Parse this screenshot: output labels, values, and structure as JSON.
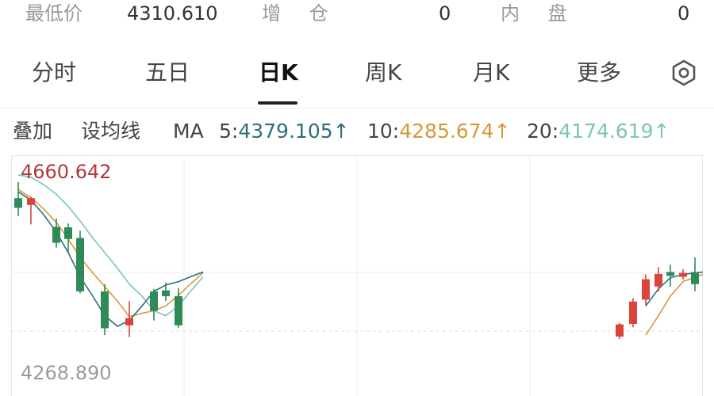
{
  "stats": {
    "low_label": "最低价",
    "low_value": "4310.610",
    "add_pos_label": "增 仓",
    "add_pos_value": "0",
    "inner_label": "内 盘",
    "inner_value": "0"
  },
  "tabs": [
    {
      "label": "分时"
    },
    {
      "label": "五日"
    },
    {
      "label": "日K",
      "active": true
    },
    {
      "label": "周K"
    },
    {
      "label": "月K"
    },
    {
      "label": "更多"
    }
  ],
  "icons": {
    "settings": "hexagon-gear-icon"
  },
  "ma_bar": {
    "overlay": "叠加",
    "set_ma": "设均线",
    "ma_label": "MA",
    "ma5_label": "5:",
    "ma5_value": "4379.105",
    "ma10_label": "10:",
    "ma10_value": "4285.674",
    "ma20_label": "20:",
    "ma20_value": "4174.619",
    "arrow": "↑",
    "colors": {
      "ma5": "#2f6f7a",
      "ma10": "#d49a37",
      "ma20": "#7cc4b8"
    }
  },
  "chart_data": {
    "type": "candlestick",
    "max_label": "4660.642",
    "visible_price_label": "4268.890",
    "y_range": [
      4200,
      4660.642
    ],
    "up_color": "#d9443b",
    "down_color": "#2e8b57",
    "candles": [
      {
        "o": 4582,
        "h": 4615,
        "l": 4545,
        "c": 4562
      },
      {
        "o": 4568,
        "h": 4585,
        "l": 4528,
        "c": 4582
      },
      {
        "o": 4523,
        "h": 4540,
        "l": 4480,
        "c": 4490
      },
      {
        "o": 4522,
        "h": 4530,
        "l": 4468,
        "c": 4498
      },
      {
        "o": 4500,
        "h": 4515,
        "l": 4386,
        "c": 4390
      },
      {
        "o": 4390,
        "h": 4405,
        "l": 4300,
        "c": 4314
      },
      {
        "o": 4320,
        "h": 4370,
        "l": 4296,
        "c": 4335
      },
      {
        "o": 4390,
        "h": 4395,
        "l": 4330,
        "c": 4350
      },
      {
        "o": 4392,
        "h": 4408,
        "l": 4370,
        "c": 4380
      },
      {
        "o": 4380,
        "h": 4397,
        "l": 4315,
        "c": 4320
      },
      {
        "o": 4297,
        "h": 4325,
        "l": 4292,
        "c": 4322
      },
      {
        "o": 4323,
        "h": 4376,
        "l": 4316,
        "c": 4369
      },
      {
        "o": 4373,
        "h": 4425,
        "l": 4360,
        "c": 4415
      },
      {
        "o": 4400,
        "h": 4440,
        "l": 4390,
        "c": 4426
      },
      {
        "o": 4430,
        "h": 4445,
        "l": 4400,
        "c": 4422
      },
      {
        "o": 4420,
        "h": 4436,
        "l": 4414,
        "c": 4428
      },
      {
        "o": 4430,
        "h": 4460,
        "l": 4390,
        "c": 4405
      },
      {
        "o": 4400,
        "h": 4420,
        "l": 4380,
        "c": 4412
      }
    ],
    "ma5": [
      4595,
      4578,
      4548,
      4512,
      4470,
      4420,
      4380,
      4340,
      4318,
      4330,
      4360,
      4390,
      4403,
      4410,
      4420,
      4430
    ],
    "ma10": [
      4600,
      4583,
      4560,
      4532,
      4498,
      4460,
      4428,
      4400,
      4370,
      4338,
      4345,
      4350,
      4360,
      4382,
      4405,
      4428
    ],
    "ma20": [
      4630,
      4625,
      4610,
      4590,
      4565,
      4535,
      4500,
      4470,
      4438,
      4405,
      4380,
      4350,
      4340,
      4360,
      4390,
      4420
    ]
  }
}
